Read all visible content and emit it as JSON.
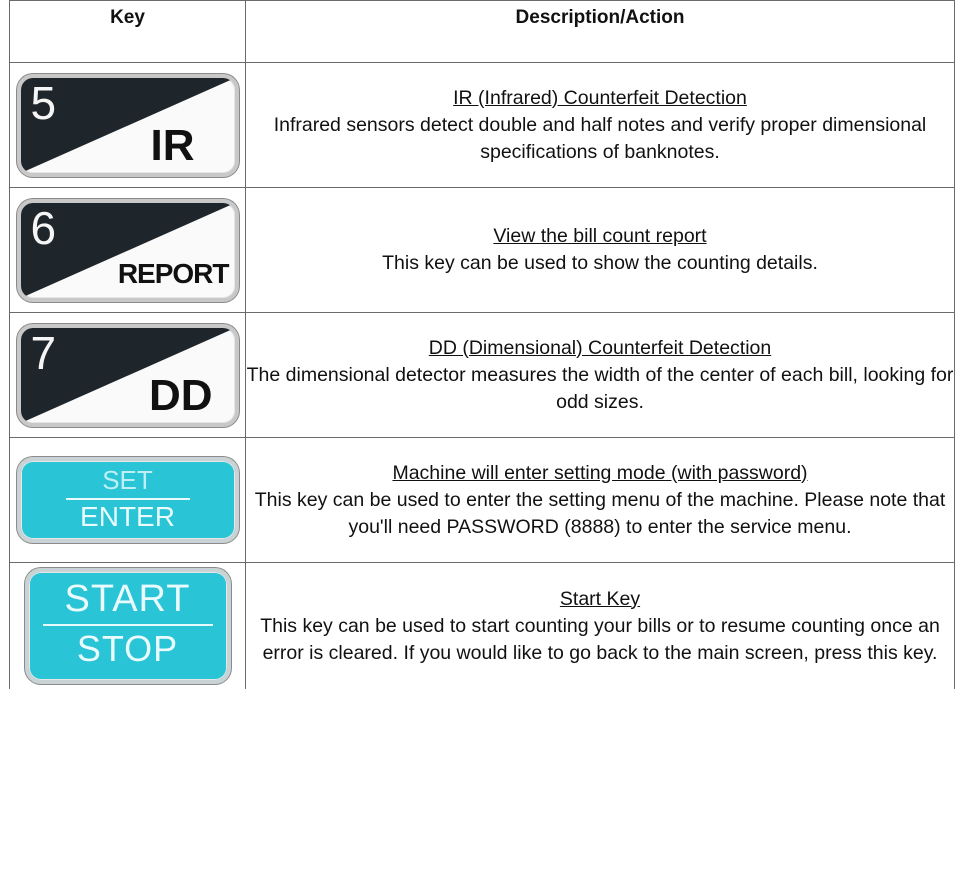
{
  "table": {
    "headers": {
      "key": "Key",
      "description": "Description/Action"
    },
    "rows": [
      {
        "key": {
          "number": "5",
          "label": "IR",
          "style": "white-black",
          "icon": "ir-key-icon"
        },
        "title": "IR (Infrared) Counterfeit Detection",
        "body": "Infrared sensors detect double and half notes and verify proper dimensional specifications of banknotes."
      },
      {
        "key": {
          "number": "6",
          "label": "REPORT",
          "style": "white-black",
          "icon": "report-key-icon"
        },
        "title": "View the bill count report",
        "body": "This key can be used to show the counting details."
      },
      {
        "key": {
          "number": "7",
          "label": "DD",
          "style": "white-black",
          "icon": "dd-key-icon"
        },
        "title": "DD (Dimensional) Counterfeit Detection",
        "body": "The dimensional detector measures the width of the center of each bill, looking for odd sizes."
      },
      {
        "key": {
          "top": "SET",
          "bottom": "ENTER",
          "style": "cyan",
          "icon": "set-enter-key-icon"
        },
        "title": "Machine will enter setting mode (with password)",
        "body": "This key can be used to enter the setting menu of the machine. Please note that you'll need PASSWORD (8888) to enter the service menu."
      },
      {
        "key": {
          "top": "START",
          "bottom": "STOP",
          "style": "cyan",
          "icon": "start-stop-key-icon"
        },
        "title": "Start Key",
        "body": "This key can be used to start counting your bills or to resume counting once an error is cleared. If you would like to go back to the main screen, press this key."
      }
    ]
  },
  "colors": {
    "key_cyan": "#29c4d6",
    "key_dark": "#1f262b",
    "border": "#6a6a6a"
  }
}
